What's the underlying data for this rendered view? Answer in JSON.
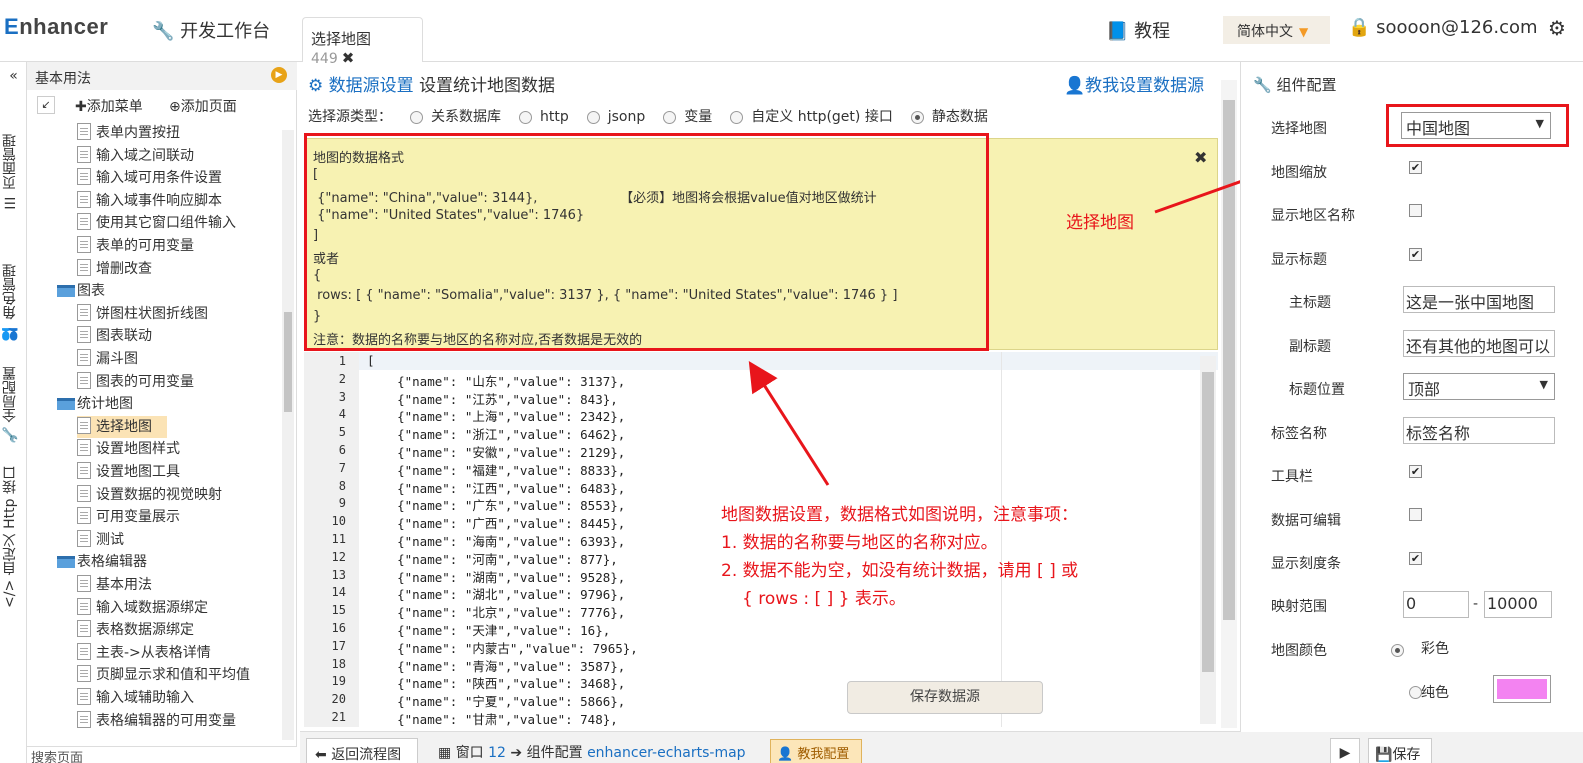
{
  "app": {
    "logo": "nhancer",
    "logo_first": "E",
    "dev_bench": "开发工作台",
    "tab_title": "选择地图",
    "tab_count": "449",
    "tutorial": "教程",
    "language": "简体中文",
    "user": "soooon@126.com"
  },
  "vtabs": [
    "页面管理",
    "角色管理",
    "全局配置",
    "自定义 Http 接口"
  ],
  "left": {
    "header": "基本用法",
    "add_menu": "添加菜单",
    "add_page": "添加页面",
    "footer": "搜索页面",
    "items": [
      {
        "label": "表单内置按扭",
        "type": "doc",
        "indent": 1
      },
      {
        "label": "输入域之间联动",
        "type": "doc",
        "indent": 1
      },
      {
        "label": "输入域可用条件设置",
        "type": "doc",
        "indent": 1
      },
      {
        "label": "输入域事件响应脚本",
        "type": "doc",
        "indent": 1
      },
      {
        "label": "使用其它窗口组件输入",
        "type": "doc",
        "indent": 1
      },
      {
        "label": "表单的可用变量",
        "type": "doc",
        "indent": 1
      },
      {
        "label": "增删改查",
        "type": "doc",
        "indent": 1
      },
      {
        "label": "图表",
        "type": "folder",
        "indent": 0
      },
      {
        "label": "饼图柱状图折线图",
        "type": "doc",
        "indent": 1
      },
      {
        "label": "图表联动",
        "type": "doc",
        "indent": 1
      },
      {
        "label": "漏斗图",
        "type": "doc",
        "indent": 1
      },
      {
        "label": "图表的可用变量",
        "type": "doc",
        "indent": 1
      },
      {
        "label": "统计地图",
        "type": "folder",
        "indent": 0
      },
      {
        "label": "选择地图",
        "type": "doc",
        "indent": 1,
        "selected": true
      },
      {
        "label": "设置地图样式",
        "type": "doc",
        "indent": 1
      },
      {
        "label": "设置地图工具",
        "type": "doc",
        "indent": 1
      },
      {
        "label": "设置数据的视觉映射",
        "type": "doc",
        "indent": 1
      },
      {
        "label": "可用变量展示",
        "type": "doc",
        "indent": 1
      },
      {
        "label": "测试",
        "type": "doc",
        "indent": 1
      },
      {
        "label": "表格编辑器",
        "type": "folder",
        "indent": 0
      },
      {
        "label": "基本用法",
        "type": "doc",
        "indent": 1
      },
      {
        "label": "输入域数据源绑定",
        "type": "doc",
        "indent": 1
      },
      {
        "label": "表格数据源绑定",
        "type": "doc",
        "indent": 1
      },
      {
        "label": "主表->从表格详情",
        "type": "doc",
        "indent": 1
      },
      {
        "label": "页脚显示求和值和平均值",
        "type": "doc",
        "indent": 1
      },
      {
        "label": "输入域辅助输入",
        "type": "doc",
        "indent": 1
      },
      {
        "label": "表格编辑器的可用变量",
        "type": "doc",
        "indent": 1
      }
    ]
  },
  "main": {
    "title_blue": "数据源设置",
    "title": "设置统计地图数据",
    "teach_link": "教我设置数据源",
    "source_type_label": "选择源类型：",
    "source_types": [
      "关系数据库",
      "http",
      "jsonp",
      "变量",
      "自定义 http(get) 接口",
      "静态数据"
    ],
    "selected_source": "静态数据",
    "note_lines": [
      "地图的数据格式",
      "[",
      " {\"name\": \"China\",\"value\": 3144},                    【必须】地图将会根据value值对地区做统计",
      " {\"name\": \"United States\",\"value\": 1746}",
      "]",
      "或者",
      "{",
      " rows: [ { \"name\": \"Somalia\",\"value\": 3137 }, { \"name\": \"United States\",\"value\": 1746 } ]",
      "}",
      "注意：数据的名称要与地区的名称对应,否者数据是无效的"
    ],
    "code_lines": [
      "[",
      "    {\"name\": \"山东\",\"value\": 3137},",
      "    {\"name\": \"江苏\",\"value\": 843},",
      "    {\"name\": \"上海\",\"value\": 2342},",
      "    {\"name\": \"浙江\",\"value\": 6462},",
      "    {\"name\": \"安徽\",\"value\": 2129},",
      "    {\"name\": \"福建\",\"value\": 8833},",
      "    {\"name\": \"江西\",\"value\": 6483},",
      "    {\"name\": \"广东\",\"value\": 8553},",
      "    {\"name\": \"广西\",\"value\": 8445},",
      "    {\"name\": \"海南\",\"value\": 6393},",
      "    {\"name\": \"河南\",\"value\": 877},",
      "    {\"name\": \"湖南\",\"value\": 9528},",
      "    {\"name\": \"湖北\",\"value\": 9796},",
      "    {\"name\": \"北京\",\"value\": 7776},",
      "    {\"name\": \"天津\",\"value\": 16},",
      "    {\"name\": \"内蒙古\",\"value\": 7965},",
      "    {\"name\": \"青海\",\"value\": 3587},",
      "    {\"name\": \"陕西\",\"value\": 3468},",
      "    {\"name\": \"宁夏\",\"value\": 5866},",
      "    {\"name\": \"甘肃\",\"value\": 748},"
    ],
    "save_button": "保存数据源"
  },
  "annotations": {
    "select_map": "选择地图",
    "data_note_1": "地图数据设置，数据格式如图说明，注意事项：",
    "data_note_2": "1. 数据的名称要与地区的名称对应。",
    "data_note_3": "2. 数据不能为空，如没有统计数据，请用 [ ]  或",
    "data_note_4": "{ rows : [ ] } 表示。"
  },
  "bottom": {
    "back": "返回流程图",
    "window": "窗口",
    "window_no": "12",
    "component": "组件配置",
    "component_name": "enhancer-echarts-map",
    "teach_cfg": "教我配置",
    "save": "保存"
  },
  "right": {
    "title": "组件配置",
    "select_map_label": "选择地图",
    "select_map_value": "中国地图",
    "zoom_label": "地图缩放",
    "zoom_checked": true,
    "show_region_label": "显示地区名称",
    "show_region_checked": false,
    "show_title_label": "显示标题",
    "show_title_checked": true,
    "main_title_label": "主标题",
    "main_title_value": "这是一张中国地图",
    "sub_title_label": "副标题",
    "sub_title_value": "还有其他的地图可以",
    "title_pos_label": "标题位置",
    "title_pos_value": "顶部",
    "tag_name_label": "标签名称",
    "tag_name_value": "标签名称",
    "toolbar_label": "工具栏",
    "toolbar_checked": true,
    "data_editable_label": "数据可编辑",
    "data_editable_checked": false,
    "show_scale_label": "显示刻度条",
    "show_scale_checked": true,
    "range_label": "映射范围",
    "range_min": "0",
    "range_sep": "-",
    "range_max": "10000",
    "map_color_label": "地图颜色",
    "color_option": "彩色",
    "mono_option": "纯色",
    "mono_color": "#f383f1"
  },
  "colors": {
    "accent_blue": "#1a6fc2",
    "annotation_red": "#e8151b",
    "note_bg": "#f7f2b2"
  }
}
